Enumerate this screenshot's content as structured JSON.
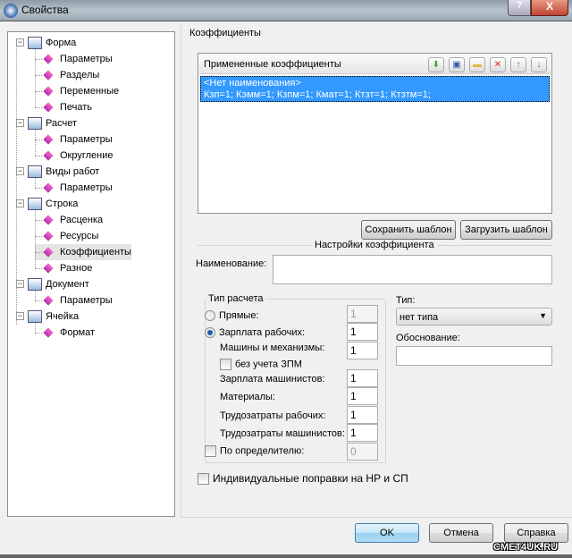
{
  "window": {
    "title": "Свойства",
    "help": "?",
    "close": "X"
  },
  "tree": [
    {
      "label": "Форма",
      "level": 0,
      "children": [
        "Параметры",
        "Разделы",
        "Переменные",
        "Печать"
      ]
    },
    {
      "label": "Расчет",
      "level": 0,
      "children": [
        "Параметры",
        "Округление"
      ]
    },
    {
      "label": "Виды работ",
      "level": 0,
      "children": [
        "Параметры"
      ]
    },
    {
      "label": "Строка",
      "level": 0,
      "children": [
        "Расценка",
        "Ресурсы",
        "Коэффициенты",
        "Разное"
      ]
    },
    {
      "label": "Документ",
      "level": 0,
      "children": [
        "Параметры"
      ]
    },
    {
      "label": "Ячейка",
      "level": 0,
      "children": [
        "Формат"
      ]
    }
  ],
  "coeff": {
    "group_label": "Коэффициенты",
    "list_header": "Примененные коэффициенты",
    "toolbar_icons": [
      "add-icon",
      "save-icon",
      "folder-icon",
      "delete-icon",
      "arrow-up-icon",
      "arrow-down-icon"
    ],
    "items": [
      {
        "name": "<Нет наименования>",
        "value": "Кзп=1; Кэмм=1; Кзпм=1; Кмат=1; Ктзт=1; Ктзтм=1;"
      }
    ],
    "save_template": "Сохранить шаблон",
    "load_template": "Загрузить шаблон"
  },
  "settings": {
    "title": "Настройки коэффициента",
    "name_label": "Наименование:",
    "name_value": "",
    "calc_group": "Тип расчета",
    "direct_label": "Прямые:",
    "direct_value": "1",
    "wage_label": "Зарплата рабочих:",
    "wage_value": "1",
    "machines_label": "Машины и механизмы:",
    "machines_value": "1",
    "no_zpm_label": "без учета ЗПМ",
    "mach_wage_label": "Зарплата машинистов:",
    "mach_wage_value": "1",
    "materials_label": "Материалы:",
    "materials_value": "1",
    "labor_label": "Трудозатраты рабочих:",
    "labor_value": "1",
    "mach_labor_label": "Трудозатраты машинистов:",
    "mach_labor_value": "1",
    "by_det_label": "По определителю:",
    "by_det_value": "0",
    "type_label": "Тип:",
    "type_value": "нет типа",
    "basis_label": "Обоснование:",
    "basis_value": "",
    "individual_label": "Индивидуальные поправки на НР и СП"
  },
  "footer": {
    "ok": "OK",
    "cancel": "Отмена",
    "help": "Справка",
    "watermark": "CMET4UK.RU"
  },
  "colors": {
    "selection": "#3399ff"
  }
}
